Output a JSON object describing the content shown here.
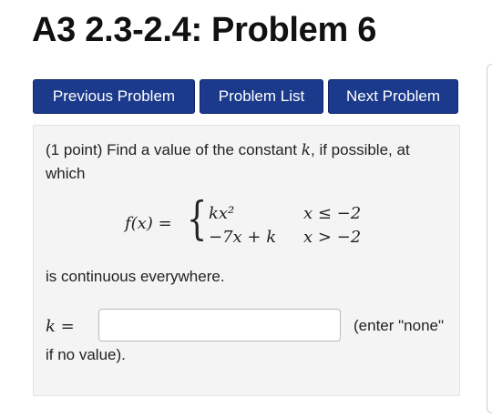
{
  "page": {
    "title": "A3 2.3-2.4: Problem 6"
  },
  "nav": {
    "previous_label": "Previous Problem",
    "list_label": "Problem List",
    "next_label": "Next Problem"
  },
  "problem": {
    "points": "(1 point) Find a value of the constant",
    "constant": "k",
    "intro_tail": ", if possible, at which",
    "function_lhs": "f(x) =",
    "pieces": [
      {
        "expression": "kx²",
        "condition": "x ≤ −2"
      },
      {
        "expression": "−7x + k",
        "condition": "x > −2"
      }
    ],
    "continuity_text": "is continuous everywhere.",
    "answer": {
      "label": "k =",
      "value": "",
      "hint": "(enter \"none\"",
      "hint_continued": "if no value)."
    }
  }
}
